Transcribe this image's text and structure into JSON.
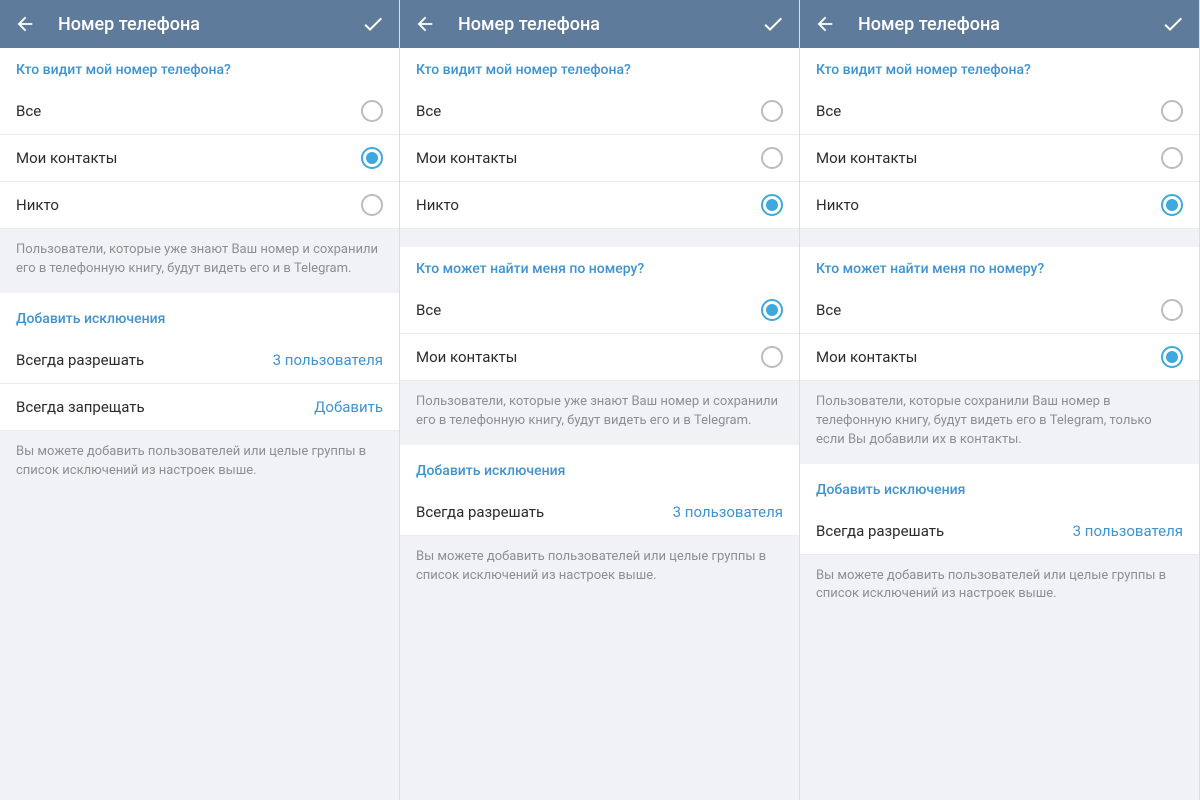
{
  "header": {
    "title": "Номер телефона"
  },
  "sections": {
    "who_sees": "Кто видит мой номер телефона?",
    "who_finds": "Кто может найти меня по номеру?",
    "exceptions": "Добавить исключения"
  },
  "options": {
    "all": "Все",
    "my_contacts": "Мои контакты",
    "nobody": "Никто"
  },
  "exceptions": {
    "always_allow": "Всегда разрешать",
    "always_deny": "Всегда запрещать",
    "add": "Добавить",
    "users_3": "3 пользователя"
  },
  "info": {
    "known_users": "Пользователи, которые уже знают Ваш номер и сохранили его в телефонную книгу, будут видеть его и в Telegram.",
    "saved_contacts": "Пользователи, которые сохранили Ваш номер в телефонную книгу, будут видеть его в Telegram, только если Вы добавили их в контакты.",
    "exceptions_info": "Вы можете добавить пользователей или целые группы в список исключений из настроек выше."
  }
}
